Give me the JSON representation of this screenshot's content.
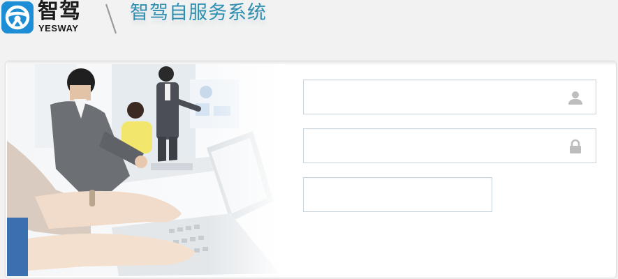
{
  "header": {
    "logo_cn": "智驾",
    "logo_en": "YESWAY",
    "system_title": "智驾自服务系统"
  },
  "login": {
    "username_placeholder": "",
    "password_placeholder": "",
    "captcha_placeholder": ""
  },
  "icons": {
    "username": "user-icon",
    "password": "lock-icon"
  },
  "colors": {
    "brand_blue": "#1d8ed6",
    "title_blue": "#2f8fb1",
    "field_border": "#c9d3dc",
    "page_bg": "#f2f2f2"
  }
}
